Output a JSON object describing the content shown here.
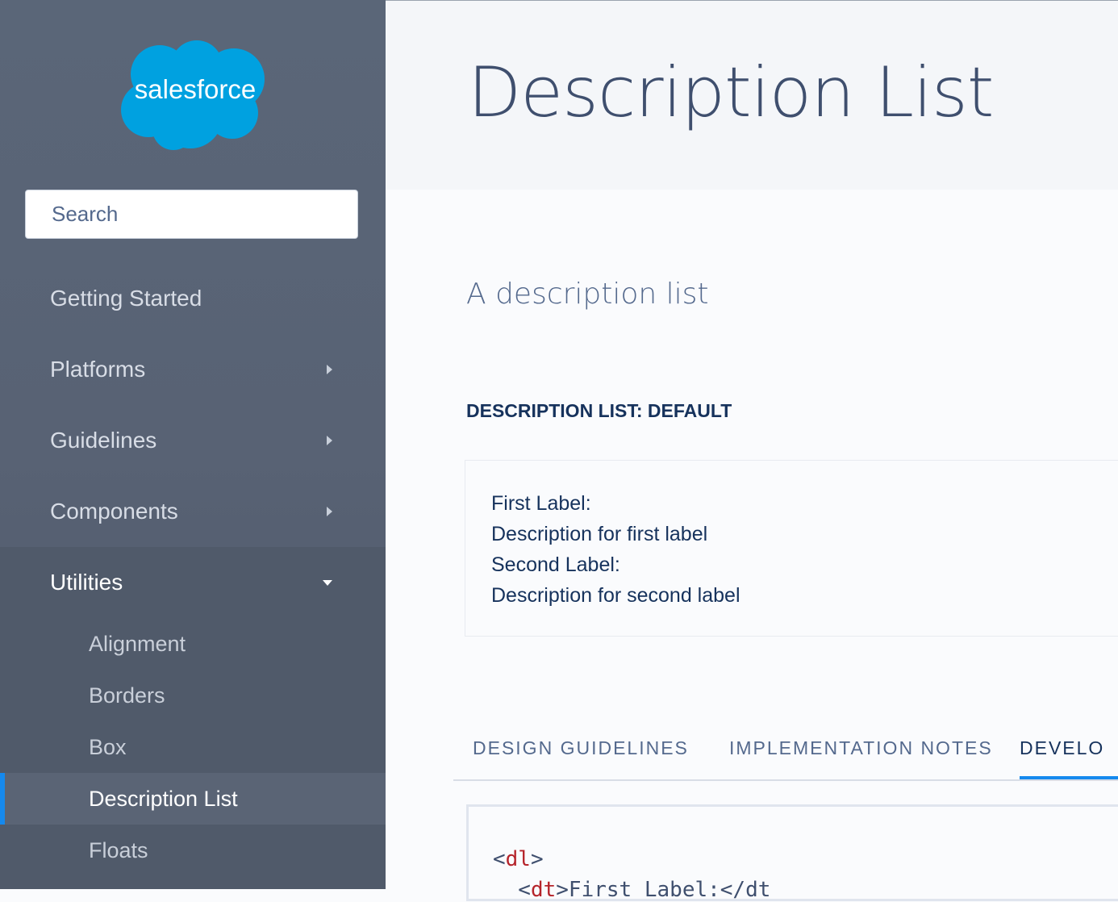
{
  "sidebar": {
    "logo_text": "salesforce",
    "search_placeholder": "Search",
    "nav": [
      {
        "label": "Getting Started",
        "expandable": false
      },
      {
        "label": "Platforms",
        "expandable": true
      },
      {
        "label": "Guidelines",
        "expandable": true
      },
      {
        "label": "Components",
        "expandable": true
      },
      {
        "label": "Utilities",
        "expandable": true,
        "expanded": true
      }
    ],
    "utilities_children": [
      {
        "label": "Alignment"
      },
      {
        "label": "Borders"
      },
      {
        "label": "Box"
      },
      {
        "label": "Description List",
        "active": true
      },
      {
        "label": "Floats"
      }
    ]
  },
  "main": {
    "page_title": "Description List",
    "section_title": "A description list",
    "example_label": "DESCRIPTION LIST: DEFAULT",
    "example": {
      "items": [
        {
          "term": "First Label:",
          "desc": "Description for first label"
        },
        {
          "term": "Second Label:",
          "desc": "Description for second label"
        }
      ]
    },
    "tabs": [
      {
        "label": "DESIGN GUIDELINES"
      },
      {
        "label": "IMPLEMENTATION NOTES"
      },
      {
        "label": "DEVELO",
        "active": true
      }
    ],
    "code": {
      "line1_open": "<",
      "line1_tag": "dl",
      "line1_close": ">",
      "line2_indent": "  <",
      "line2_tag": "dt",
      "line2_text": ">First Label:</dt"
    }
  },
  "colors": {
    "sidebar_bg": "#586274",
    "active_indicator": "#1589ee",
    "title_text": "#3f4f6e",
    "brand_blue": "#00a1e0"
  }
}
